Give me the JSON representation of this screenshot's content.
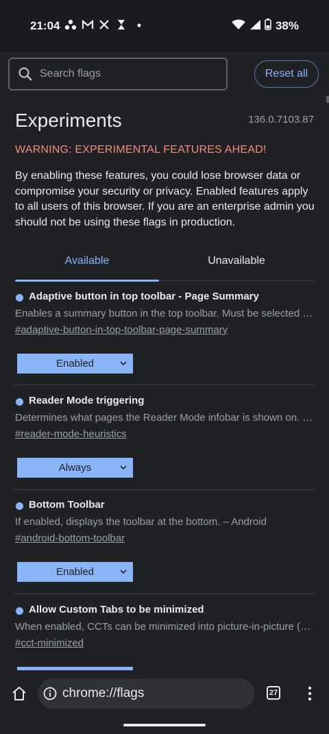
{
  "status_bar": {
    "time": "21:04",
    "battery": "38%",
    "notification_icons": [
      "cluster-icon",
      "gmail-icon",
      "x-icon",
      "hourglass-icon",
      "dot-icon"
    ]
  },
  "header": {
    "search_placeholder": "Search flags",
    "reset_label": "Reset all"
  },
  "page": {
    "title": "Experiments",
    "version": "136.0.7103.87",
    "warning_title": "WARNING: EXPERIMENTAL FEATURES AHEAD!",
    "warning_body": "By enabling these features, you could lose browser data or compromise your security or privacy. Enabled features apply to all users of this browser. If you are an enterprise admin you should not be using these flags in production."
  },
  "tabs": [
    {
      "label": "Available",
      "active": true
    },
    {
      "label": "Unavailable",
      "active": false
    }
  ],
  "flags": [
    {
      "name": "Adaptive button in top toolbar - Page Summary",
      "description": "Enables a summary button in the top toolbar. Must be selected i…",
      "link": "#adaptive-button-in-top-toolbar-page-summary",
      "value": "Enabled"
    },
    {
      "name": "Reader Mode triggering",
      "description": "Determines what pages the Reader Mode infobar is shown on. – …",
      "link": "#reader-mode-heuristics",
      "value": "Always"
    },
    {
      "name": "Bottom Toolbar",
      "description": "If enabled, displays the toolbar at the bottom. – Android",
      "link": "#android-bottom-toolbar",
      "value": "Enabled"
    },
    {
      "name": "Allow Custom Tabs to be minimized",
      "description": "When enabled, CCTs can be minimized into picture-in-picture (Pi…",
      "link": "#cct-minimized",
      "value": ""
    }
  ],
  "bottom_bar": {
    "url": "chrome://flags",
    "tab_count": "27"
  },
  "colors": {
    "background": "#202124",
    "accent": "#8ab4f8",
    "warning": "#f28b82"
  }
}
